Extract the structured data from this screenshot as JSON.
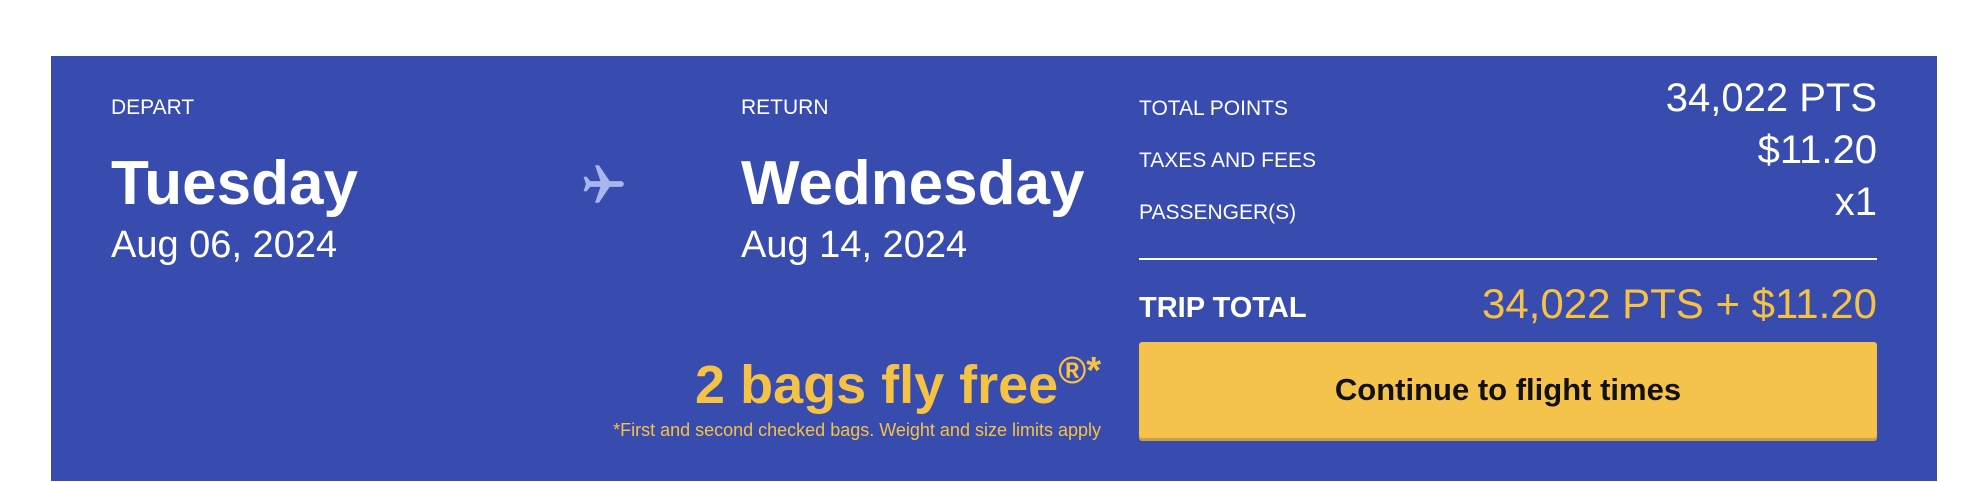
{
  "depart": {
    "label": "DEPART",
    "day": "Tuesday",
    "date": "Aug 06, 2024"
  },
  "return": {
    "label": "RETURN",
    "day": "Wednesday",
    "date": "Aug 14, 2024"
  },
  "promo": {
    "title": "2 bags fly free",
    "title_mark": "®*",
    "note": "*First and second checked bags. Weight and size limits apply"
  },
  "summary": {
    "rows": [
      {
        "label": "TOTAL POINTS",
        "value": "34,022 PTS"
      },
      {
        "label": "TAXES AND FEES",
        "value": "$11.20"
      },
      {
        "label": "PASSENGER(S)",
        "value": "x1"
      }
    ],
    "trip_total_label": "TRIP TOTAL",
    "trip_total_value": "34,022 PTS + $11.20"
  },
  "cta": {
    "label": "Continue to flight times"
  },
  "colors": {
    "banner_bg": "#384bae",
    "accent_yellow": "#f6c244",
    "button_bg": "#f5c24c",
    "plane_icon": "#a9b6ee"
  },
  "icons": {
    "trip_direction": "airplane-icon"
  }
}
